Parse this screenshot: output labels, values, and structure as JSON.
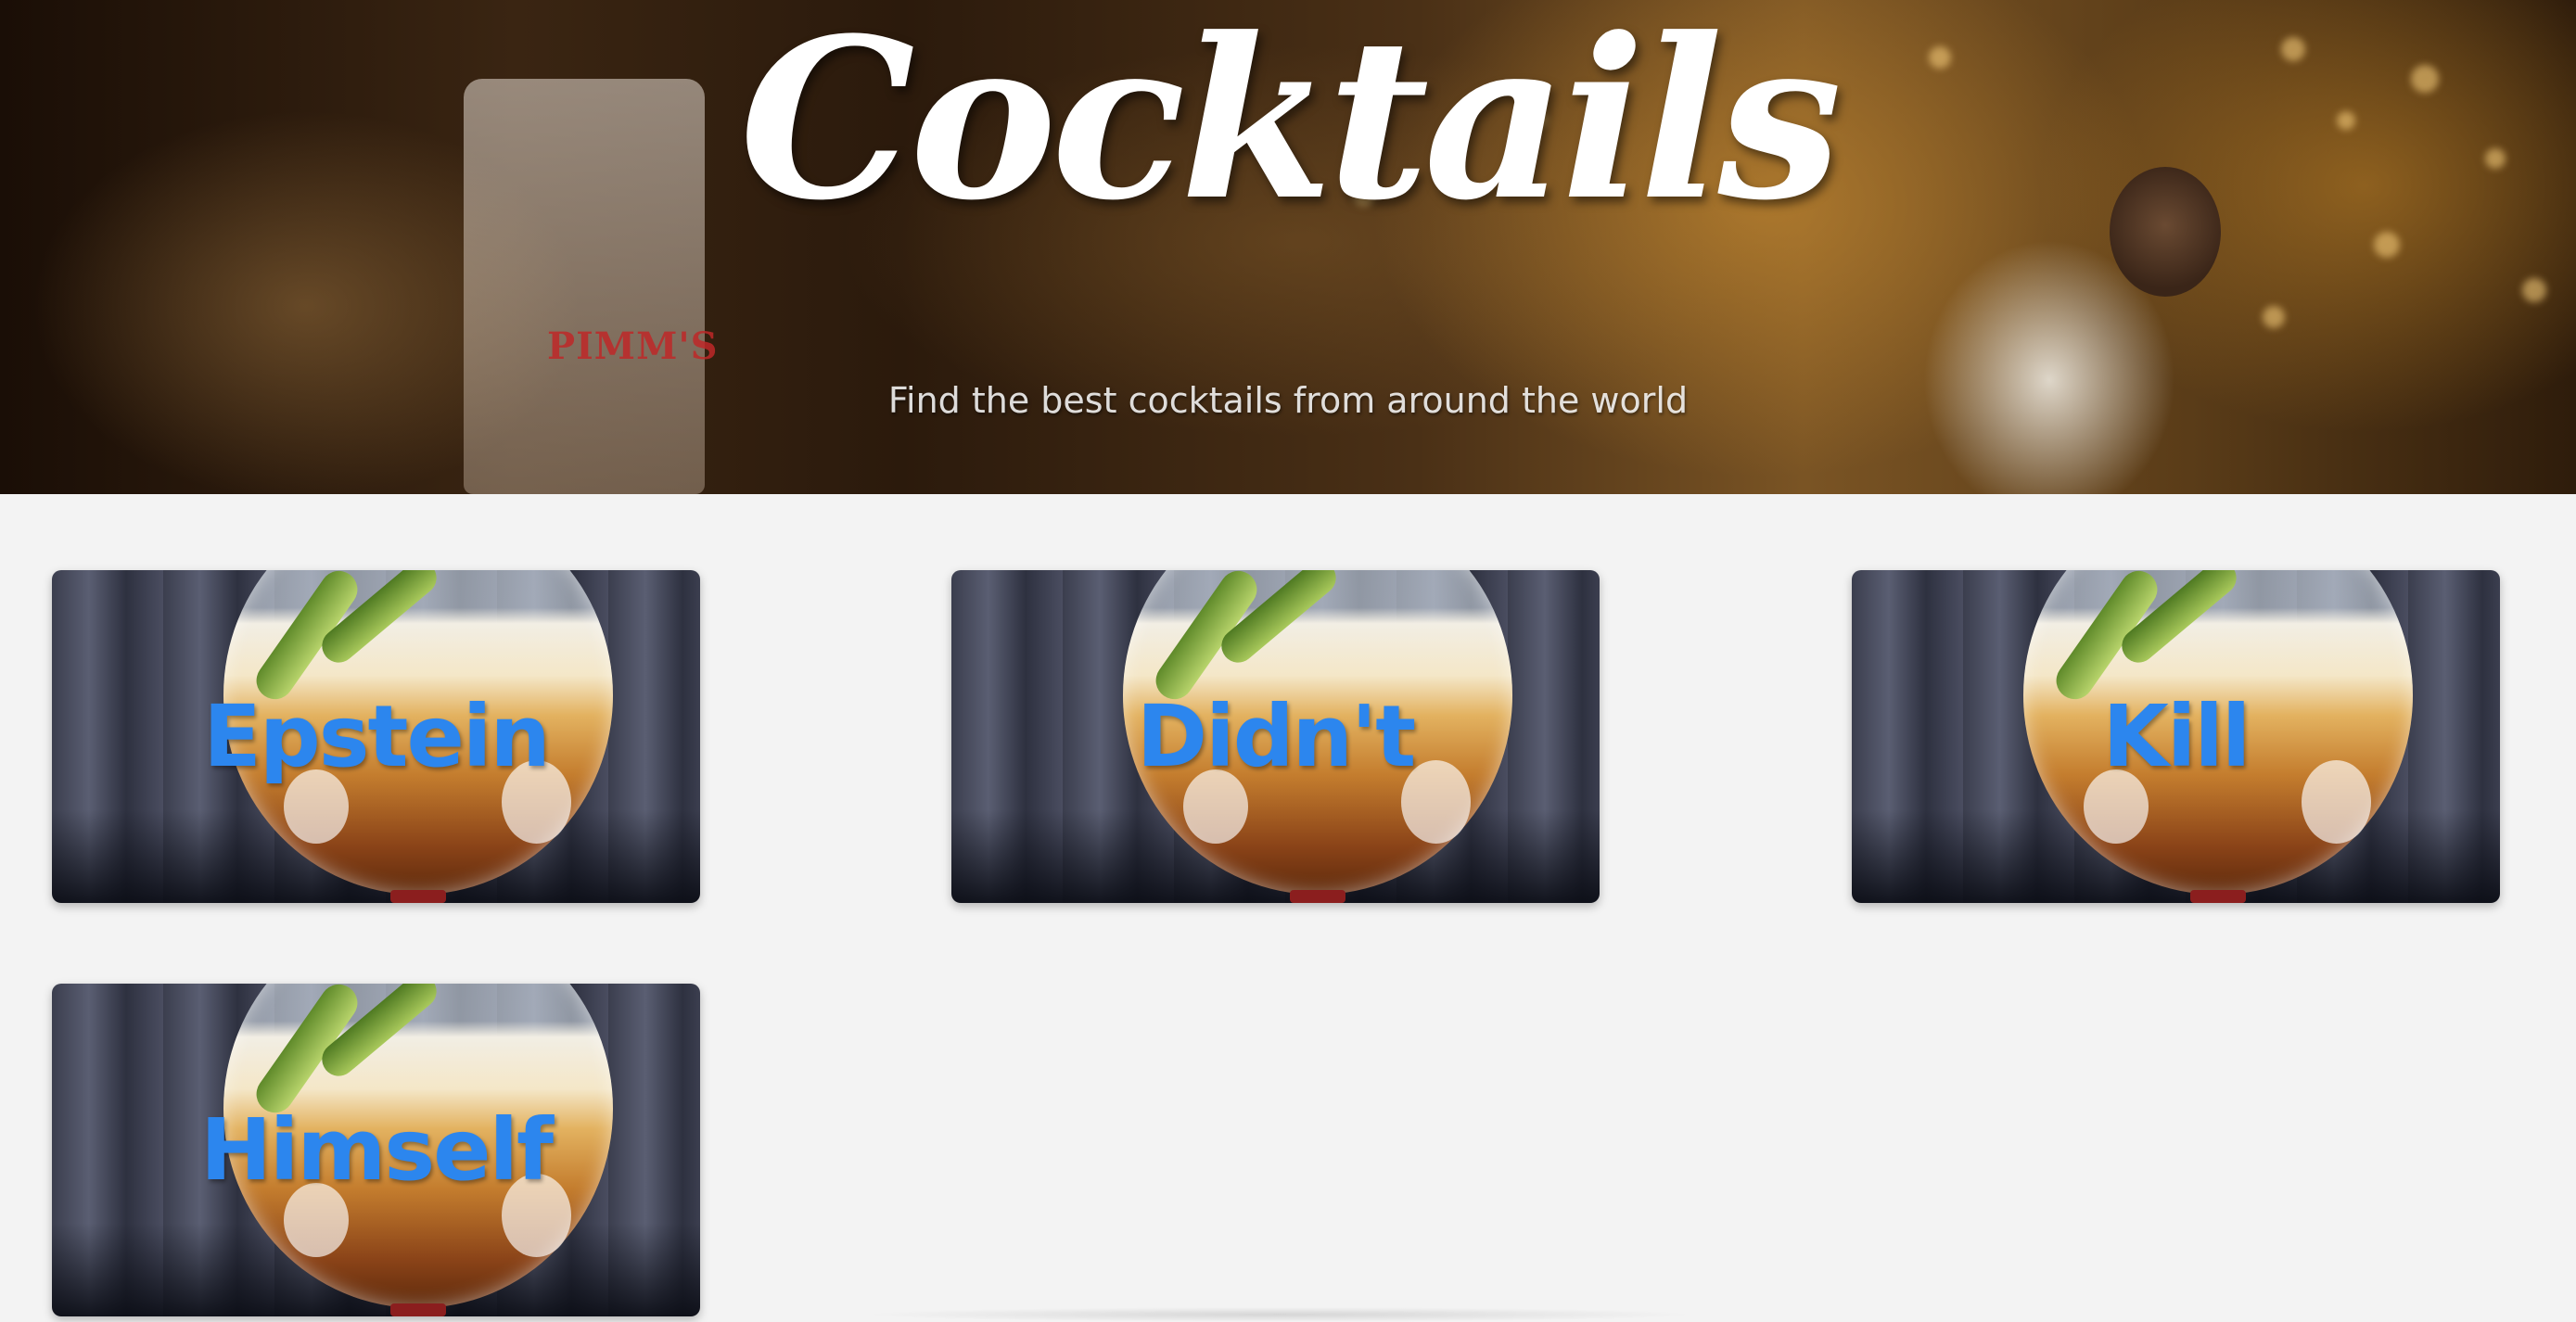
{
  "hero": {
    "title": "Cocktails",
    "subtitle": "Find the best cocktails from around the world",
    "image_text": "PIMM'S"
  },
  "cards": [
    {
      "title": "Epstein"
    },
    {
      "title": "Didn't"
    },
    {
      "title": "Kill"
    },
    {
      "title": "Himself"
    }
  ],
  "colors": {
    "background": "#f3f3f3",
    "card_title": "#2c86ee",
    "hero_title": "#ffffff"
  }
}
